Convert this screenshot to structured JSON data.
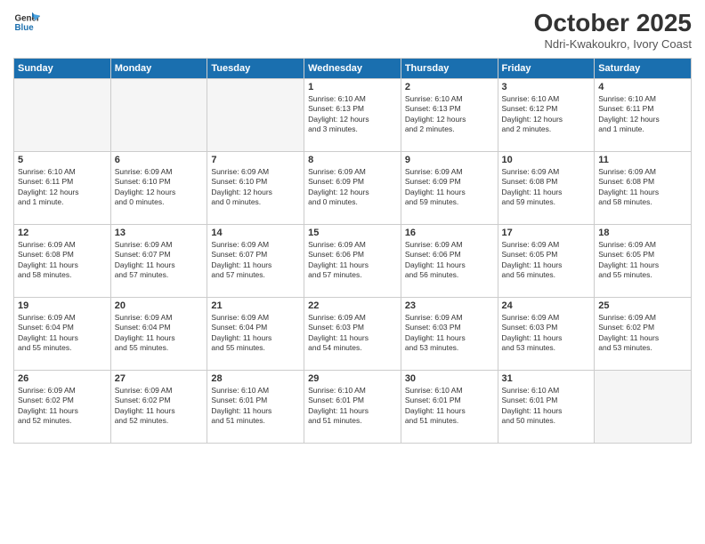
{
  "header": {
    "logo_line1": "General",
    "logo_line2": "Blue",
    "month": "October 2025",
    "location": "Ndri-Kwakoukro, Ivory Coast"
  },
  "days_of_week": [
    "Sunday",
    "Monday",
    "Tuesday",
    "Wednesday",
    "Thursday",
    "Friday",
    "Saturday"
  ],
  "weeks": [
    [
      {
        "day": "",
        "info": ""
      },
      {
        "day": "",
        "info": ""
      },
      {
        "day": "",
        "info": ""
      },
      {
        "day": "1",
        "info": "Sunrise: 6:10 AM\nSunset: 6:13 PM\nDaylight: 12 hours\nand 3 minutes."
      },
      {
        "day": "2",
        "info": "Sunrise: 6:10 AM\nSunset: 6:13 PM\nDaylight: 12 hours\nand 2 minutes."
      },
      {
        "day": "3",
        "info": "Sunrise: 6:10 AM\nSunset: 6:12 PM\nDaylight: 12 hours\nand 2 minutes."
      },
      {
        "day": "4",
        "info": "Sunrise: 6:10 AM\nSunset: 6:11 PM\nDaylight: 12 hours\nand 1 minute."
      }
    ],
    [
      {
        "day": "5",
        "info": "Sunrise: 6:10 AM\nSunset: 6:11 PM\nDaylight: 12 hours\nand 1 minute."
      },
      {
        "day": "6",
        "info": "Sunrise: 6:09 AM\nSunset: 6:10 PM\nDaylight: 12 hours\nand 0 minutes."
      },
      {
        "day": "7",
        "info": "Sunrise: 6:09 AM\nSunset: 6:10 PM\nDaylight: 12 hours\nand 0 minutes."
      },
      {
        "day": "8",
        "info": "Sunrise: 6:09 AM\nSunset: 6:09 PM\nDaylight: 12 hours\nand 0 minutes."
      },
      {
        "day": "9",
        "info": "Sunrise: 6:09 AM\nSunset: 6:09 PM\nDaylight: 11 hours\nand 59 minutes."
      },
      {
        "day": "10",
        "info": "Sunrise: 6:09 AM\nSunset: 6:08 PM\nDaylight: 11 hours\nand 59 minutes."
      },
      {
        "day": "11",
        "info": "Sunrise: 6:09 AM\nSunset: 6:08 PM\nDaylight: 11 hours\nand 58 minutes."
      }
    ],
    [
      {
        "day": "12",
        "info": "Sunrise: 6:09 AM\nSunset: 6:08 PM\nDaylight: 11 hours\nand 58 minutes."
      },
      {
        "day": "13",
        "info": "Sunrise: 6:09 AM\nSunset: 6:07 PM\nDaylight: 11 hours\nand 57 minutes."
      },
      {
        "day": "14",
        "info": "Sunrise: 6:09 AM\nSunset: 6:07 PM\nDaylight: 11 hours\nand 57 minutes."
      },
      {
        "day": "15",
        "info": "Sunrise: 6:09 AM\nSunset: 6:06 PM\nDaylight: 11 hours\nand 57 minutes."
      },
      {
        "day": "16",
        "info": "Sunrise: 6:09 AM\nSunset: 6:06 PM\nDaylight: 11 hours\nand 56 minutes."
      },
      {
        "day": "17",
        "info": "Sunrise: 6:09 AM\nSunset: 6:05 PM\nDaylight: 11 hours\nand 56 minutes."
      },
      {
        "day": "18",
        "info": "Sunrise: 6:09 AM\nSunset: 6:05 PM\nDaylight: 11 hours\nand 55 minutes."
      }
    ],
    [
      {
        "day": "19",
        "info": "Sunrise: 6:09 AM\nSunset: 6:04 PM\nDaylight: 11 hours\nand 55 minutes."
      },
      {
        "day": "20",
        "info": "Sunrise: 6:09 AM\nSunset: 6:04 PM\nDaylight: 11 hours\nand 55 minutes."
      },
      {
        "day": "21",
        "info": "Sunrise: 6:09 AM\nSunset: 6:04 PM\nDaylight: 11 hours\nand 55 minutes."
      },
      {
        "day": "22",
        "info": "Sunrise: 6:09 AM\nSunset: 6:03 PM\nDaylight: 11 hours\nand 54 minutes."
      },
      {
        "day": "23",
        "info": "Sunrise: 6:09 AM\nSunset: 6:03 PM\nDaylight: 11 hours\nand 53 minutes."
      },
      {
        "day": "24",
        "info": "Sunrise: 6:09 AM\nSunset: 6:03 PM\nDaylight: 11 hours\nand 53 minutes."
      },
      {
        "day": "25",
        "info": "Sunrise: 6:09 AM\nSunset: 6:02 PM\nDaylight: 11 hours\nand 53 minutes."
      }
    ],
    [
      {
        "day": "26",
        "info": "Sunrise: 6:09 AM\nSunset: 6:02 PM\nDaylight: 11 hours\nand 52 minutes."
      },
      {
        "day": "27",
        "info": "Sunrise: 6:09 AM\nSunset: 6:02 PM\nDaylight: 11 hours\nand 52 minutes."
      },
      {
        "day": "28",
        "info": "Sunrise: 6:10 AM\nSunset: 6:01 PM\nDaylight: 11 hours\nand 51 minutes."
      },
      {
        "day": "29",
        "info": "Sunrise: 6:10 AM\nSunset: 6:01 PM\nDaylight: 11 hours\nand 51 minutes."
      },
      {
        "day": "30",
        "info": "Sunrise: 6:10 AM\nSunset: 6:01 PM\nDaylight: 11 hours\nand 51 minutes."
      },
      {
        "day": "31",
        "info": "Sunrise: 6:10 AM\nSunset: 6:01 PM\nDaylight: 11 hours\nand 50 minutes."
      },
      {
        "day": "",
        "info": ""
      }
    ]
  ]
}
